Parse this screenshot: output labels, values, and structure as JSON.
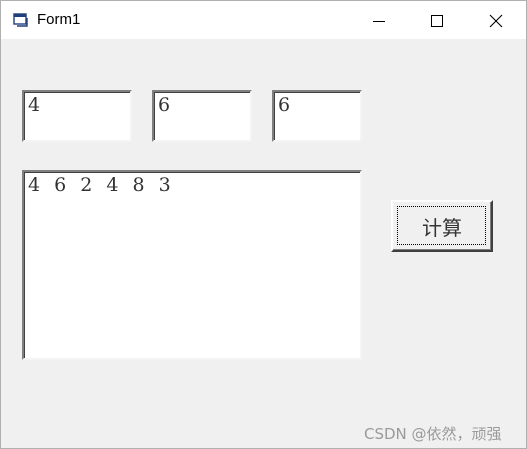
{
  "window": {
    "title": "Form1"
  },
  "inputs": {
    "a": "4",
    "b": "6",
    "c": "6"
  },
  "output": {
    "text": "4 6 2 4 8 3"
  },
  "buttons": {
    "calculate_label": "计算"
  },
  "watermark": "CSDN @依然，顽强",
  "icons": {
    "app": "form-window-icon",
    "minimize": "minimize-icon",
    "maximize": "maximize-icon",
    "close": "close-icon"
  }
}
